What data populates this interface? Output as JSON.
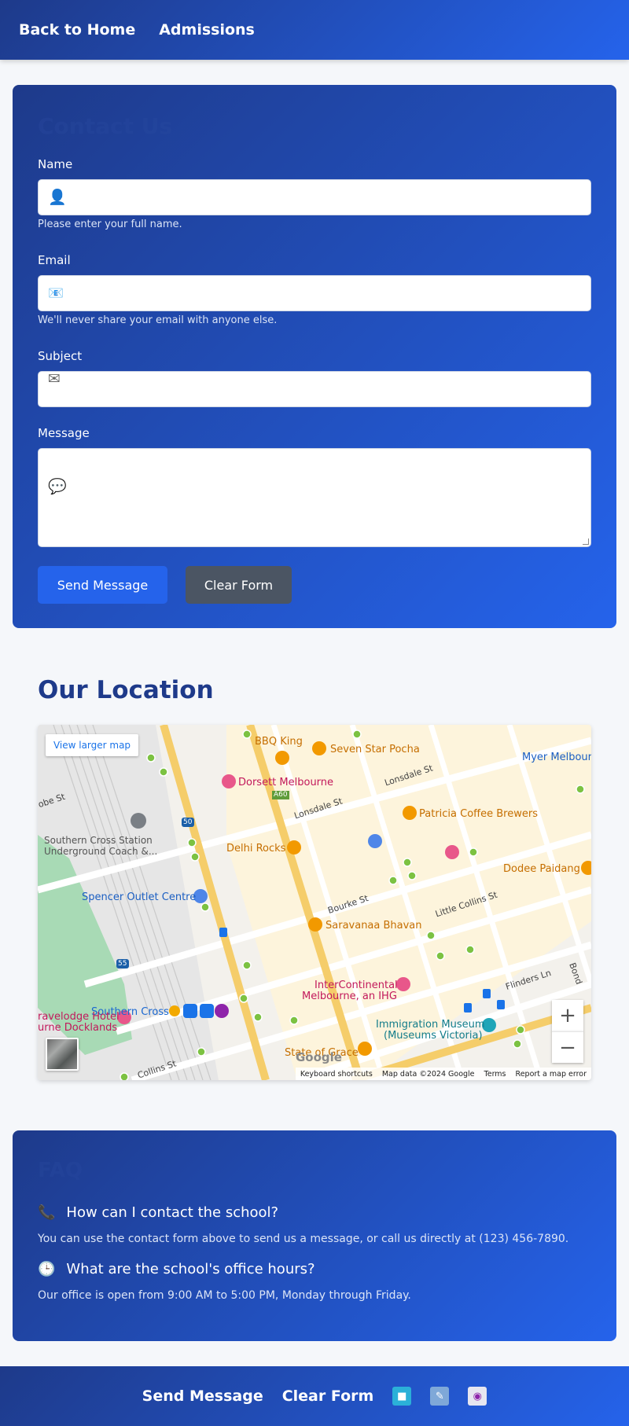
{
  "nav": {
    "home": "Back to Home",
    "admissions": "Admissions"
  },
  "form": {
    "title": "Contact Us",
    "name_label": "Name",
    "name_help": "Please enter your full name.",
    "email_label": "Email",
    "email_help": "We'll never share your email with anyone else.",
    "subject_label": "Subject",
    "message_label": "Message",
    "send_label": "Send Message",
    "clear_label": "Clear Form"
  },
  "location": {
    "title": "Our Location",
    "view_larger": "View larger map",
    "zoom_in": "+",
    "zoom_out": "−",
    "google": "Google",
    "attribution": {
      "shortcuts": "Keyboard shortcuts",
      "data": "Map data ©2024 Google",
      "terms": "Terms",
      "report": "Report a map error"
    },
    "places": {
      "bbq": "BBQ King",
      "pocha": "Seven Star Pocha",
      "dorsett": "Dorsett Melbourne",
      "patricia": "Patricia Coffee Brewers",
      "delhi": "Delhi Rocks",
      "dodee": "Dodee Paidang",
      "spencer": "Spencer Outlet Centre",
      "saravanaa": "Saravanaa Bhavan",
      "intercon1": "InterContinental",
      "intercon2": "Melbourne, an IHG",
      "southern": "Southern Cross",
      "travelodge1": "ravelodge Hotel",
      "travelodge2": "urne Docklands",
      "museum1": "Immigration Museum",
      "museum2": "(Museums Victoria)",
      "grace": "State of Grace",
      "coach1": "Southern Cross Station",
      "coach2": "Underground Coach &...",
      "myer": "Myer Melbourn",
      "lonsdale1": "Lonsdale St",
      "lonsdale2": "Lonsdale St",
      "bourke": "Bourke St",
      "little_collins": "Little Collins St",
      "flinders": "Flinders Ln",
      "collins": "Collins St",
      "lobe": "obe St",
      "bond": "Bond",
      "a60": "A60",
      "r50": "50",
      "r55": "55"
    }
  },
  "faq": {
    "title": "FAQ",
    "q1": "How can I contact the school?",
    "a1": "You can use the contact form above to send us a message, or call us directly at (123) 456-7890.",
    "q2": "What are the school's office hours?",
    "a2": "Our office is open from 9:00 AM to 5:00 PM, Monday through Friday."
  },
  "footer": {
    "send": "Send Message",
    "clear": "Clear Form"
  },
  "icons": {
    "name": "person-icon",
    "email": "envelope-icon",
    "subject": "mail-icon",
    "message": "speech-bubble-icon",
    "phone": "phone-icon",
    "clock": "clock-icon",
    "social": [
      "facebook-icon",
      "twitter-icon",
      "instagram-icon"
    ]
  },
  "colors": {
    "gradient_start": "#1e3a8a",
    "gradient_end": "#2563eb",
    "primary": "#2563eb",
    "secondary": "#4b5563"
  }
}
